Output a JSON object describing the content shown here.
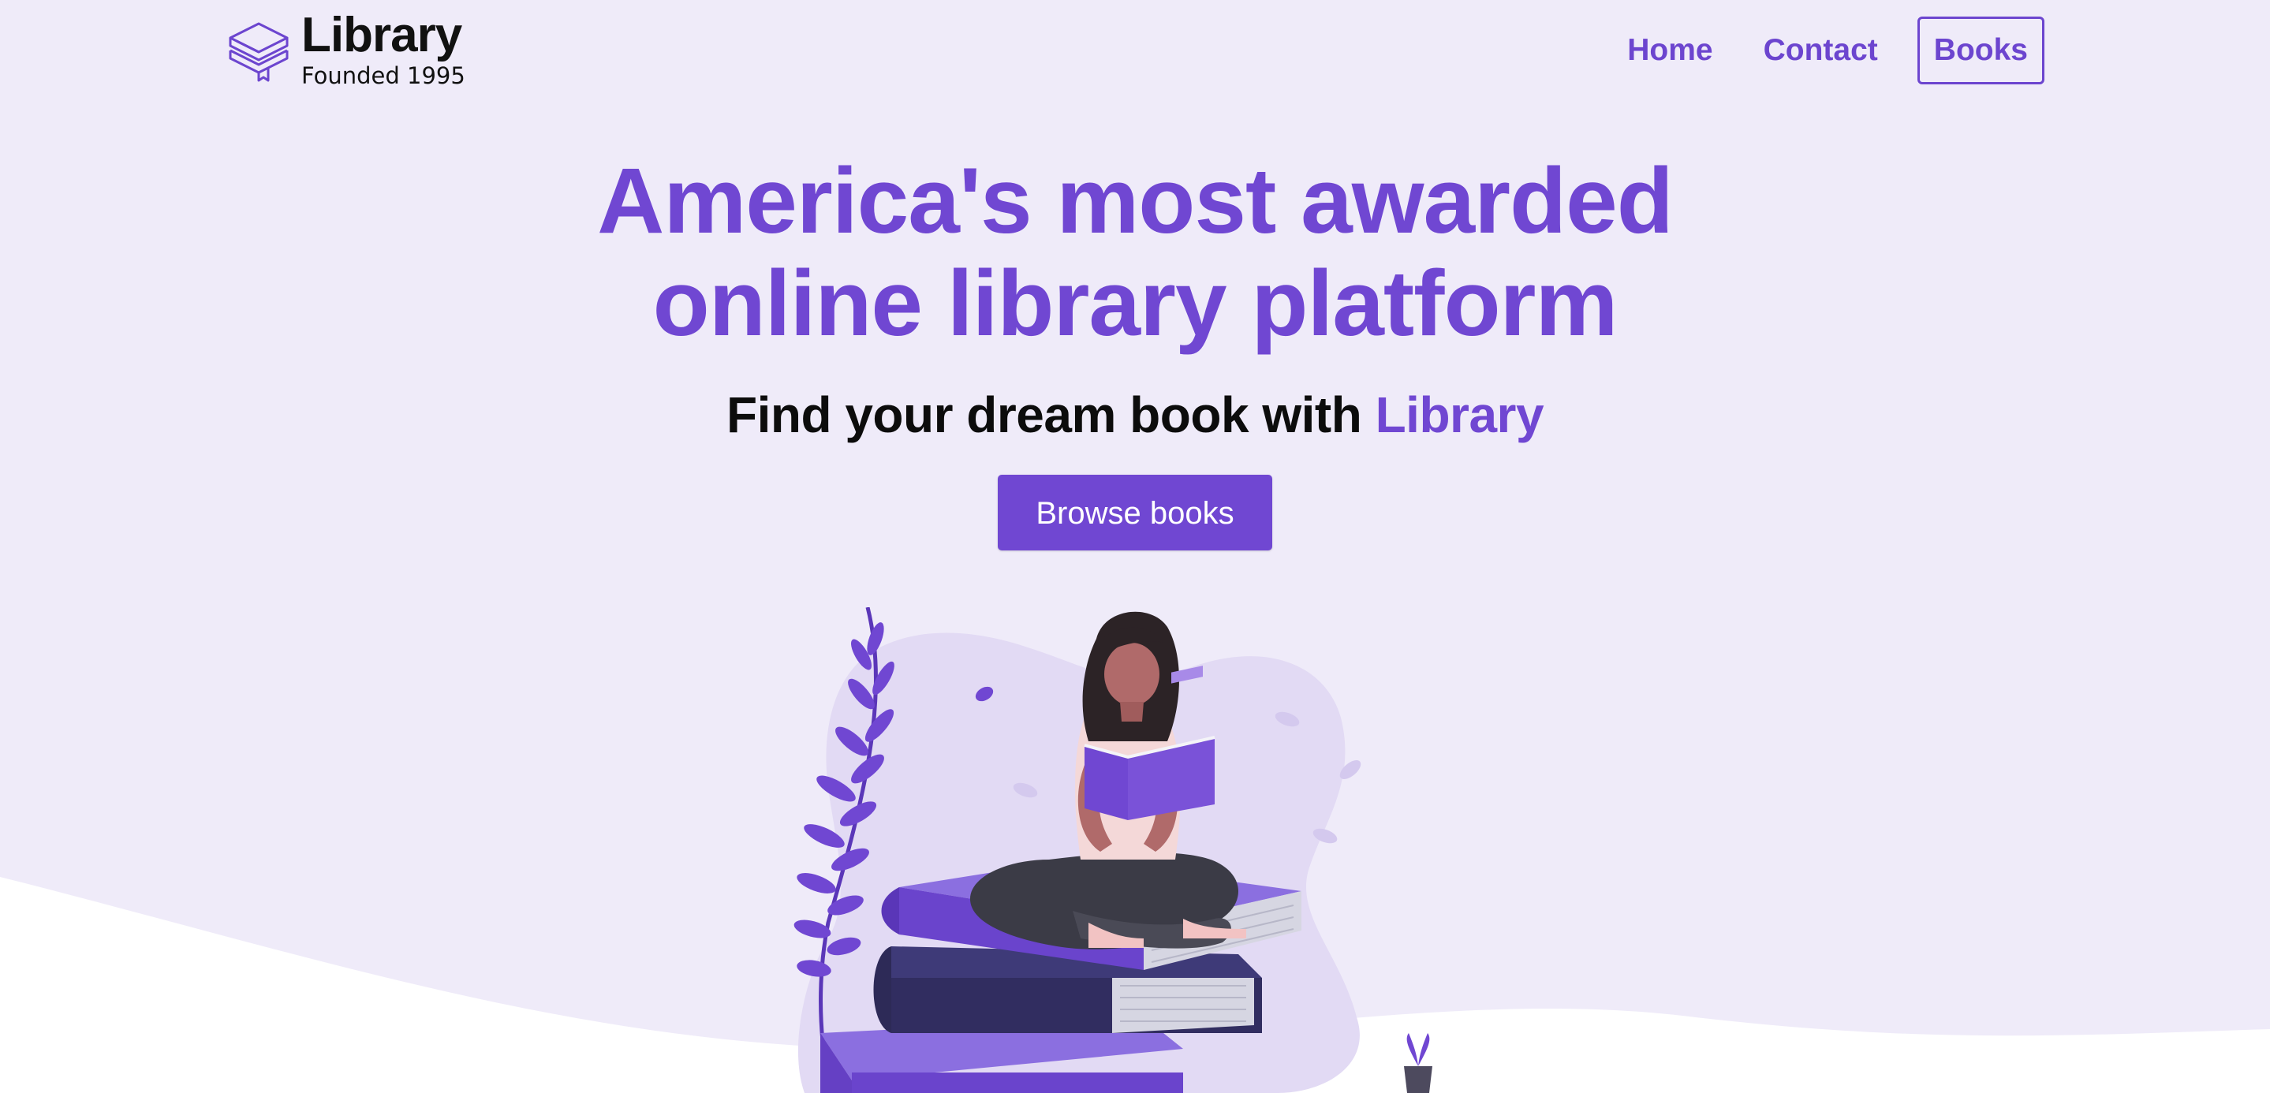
{
  "brand": {
    "title": "Library",
    "subtitle": "Founded 1995",
    "icon": "stacked-books-icon"
  },
  "nav": {
    "items": [
      {
        "label": "Home",
        "active": false
      },
      {
        "label": "Contact",
        "active": false
      },
      {
        "label": "Books",
        "active": true
      }
    ]
  },
  "hero": {
    "title_line1": "America's most awarded",
    "title_line2": "online library platform",
    "subtitle_prefix": "Find your dream book with ",
    "subtitle_accent": "Library",
    "cta_label": "Browse books"
  },
  "colors": {
    "accent": "#7047d2",
    "background": "#efebf9",
    "text": "#0c0c0c"
  },
  "illustration": {
    "subject": "woman-reading-on-book-stack-illustration"
  }
}
